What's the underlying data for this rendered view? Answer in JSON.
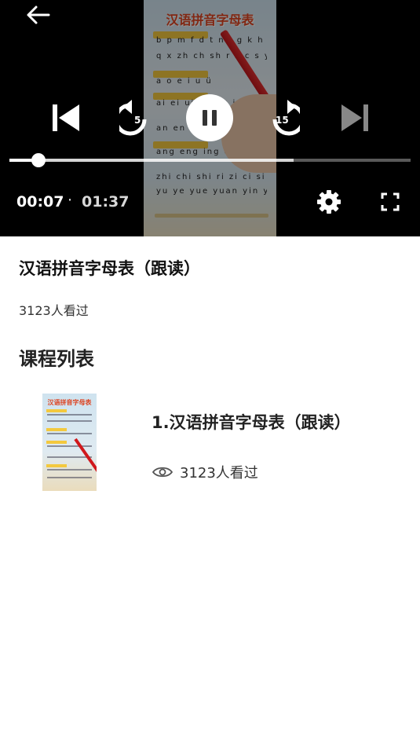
{
  "player": {
    "back_icon": "arrow-left-icon",
    "prev_icon": "skip-previous-icon",
    "rewind_icon": "rewind-5-icon",
    "rewind_label": "5",
    "pause_icon": "pause-icon",
    "forward_icon": "forward-15-icon",
    "forward_label": "15",
    "next_icon": "skip-next-icon",
    "current_time": "00:07",
    "separator": "·",
    "total_time": "01:37",
    "progress_fraction": 0.072,
    "buffered_fraction": 0.708,
    "settings_icon": "gear-icon",
    "fullscreen_icon": "fullscreen-icon",
    "thumbnail": {
      "title": "汉语拼音字母表",
      "rows": [
        "b p m f d t n l g k h j",
        "q x zh ch sh r z c s y w",
        "a o e i u ü",
        "ai ei ui ao ou iu ie üe er",
        "an en in un ün",
        "ang eng ing ong",
        "zhi chi shi ri zi ci si yi wu",
        "yu ye yue yuan yin yun ying"
      ]
    }
  },
  "video": {
    "title": "汉语拼音字母表（跟读）",
    "views": "3123人看过"
  },
  "course_list": {
    "heading": "课程列表",
    "items": [
      {
        "title": "1.汉语拼音字母表（跟读）",
        "views": "3123人看过",
        "views_icon": "eye-icon",
        "thumb_title": "汉语拼音字母表"
      }
    ]
  },
  "colors": {
    "player_bg": "#000000",
    "thumb_title_red": "#dd4422",
    "pencil_red": "#d0181c"
  }
}
